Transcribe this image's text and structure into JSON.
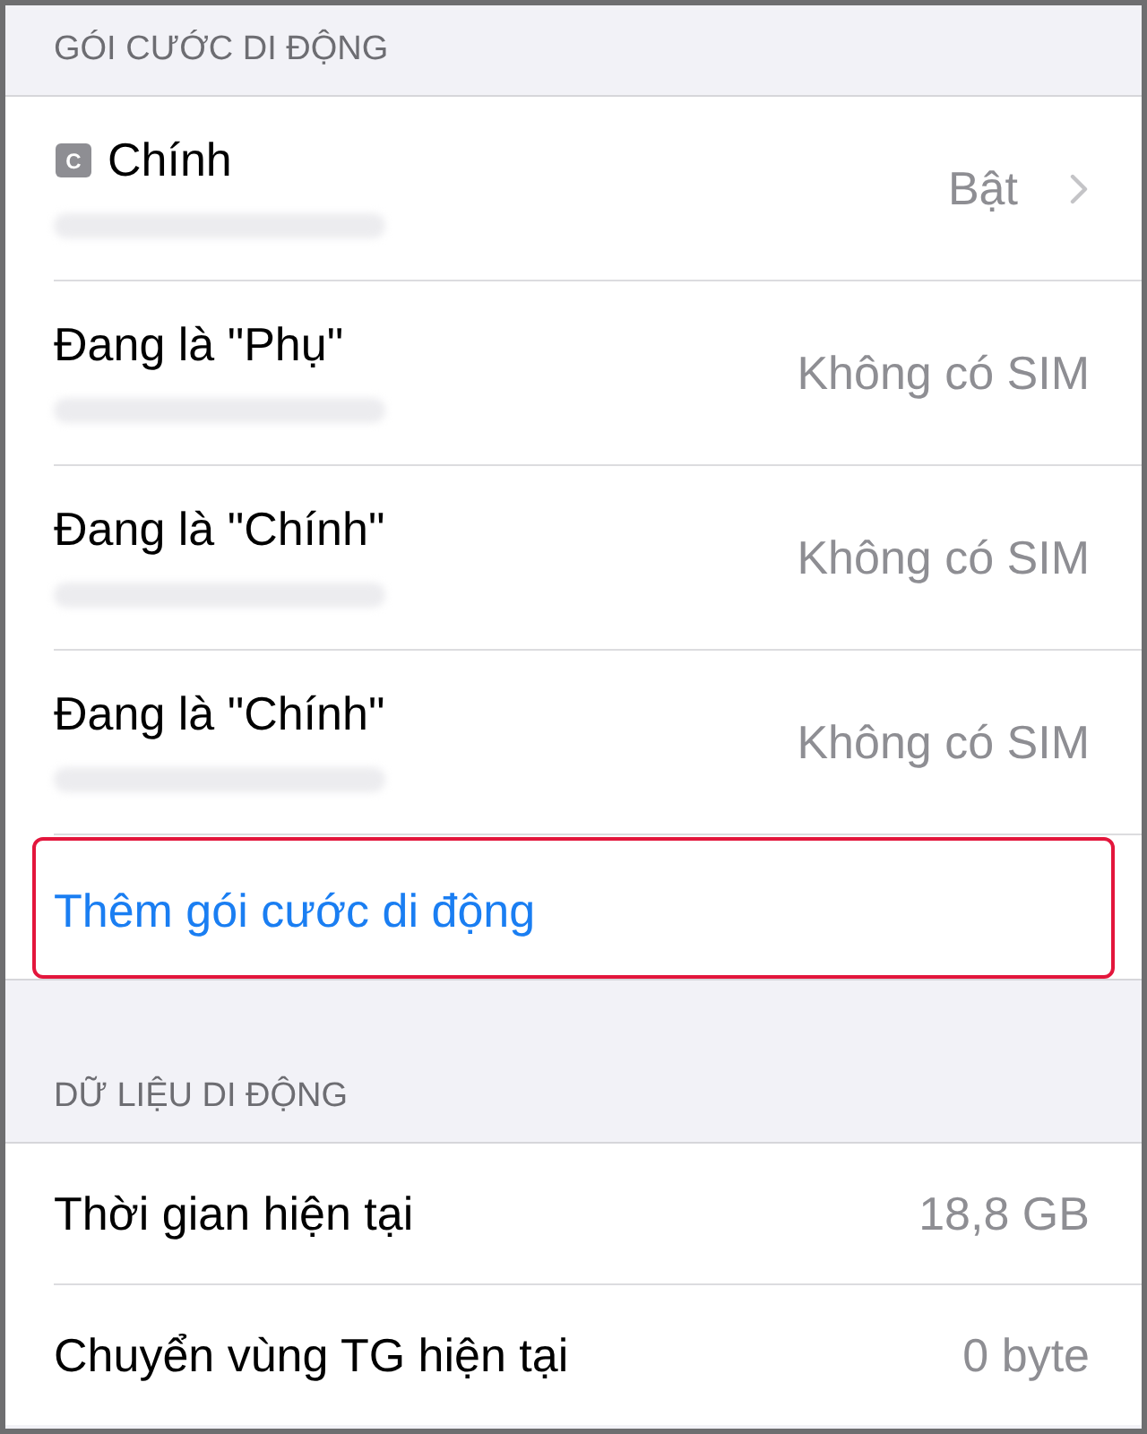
{
  "mobile_plans": {
    "header": "GÓI CƯỚC DI ĐỘNG",
    "plans": [
      {
        "badge": "C",
        "name": "Chính",
        "status": "Bật",
        "chevron": true,
        "redacted": true
      },
      {
        "name": "Đang là \"Phụ\"",
        "status": "Không có SIM",
        "chevron": false,
        "redacted": true
      },
      {
        "name": "Đang là \"Chính\"",
        "status": "Không có SIM",
        "chevron": false,
        "redacted": true
      },
      {
        "name": "Đang là \"Chính\"",
        "status": "Không có SIM",
        "chevron": false,
        "redacted": true
      }
    ],
    "add_plan": {
      "label": "Thêm gói cước di động",
      "highlighted": true
    }
  },
  "cellular_data": {
    "header": "DỮ LIỆU DI ĐỘNG",
    "rows": [
      {
        "label": "Thời gian hiện tại",
        "value": "18,8 GB"
      },
      {
        "label": "Chuyển vùng TG hiện tại",
        "value": "0 byte"
      }
    ]
  }
}
